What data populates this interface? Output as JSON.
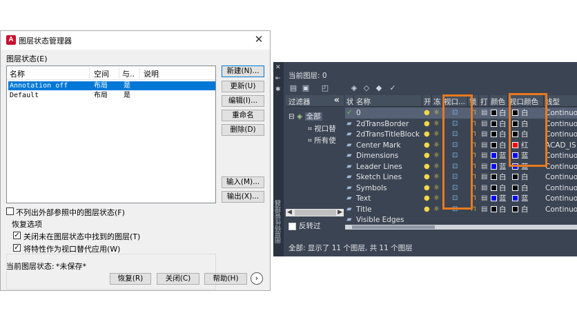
{
  "dialog": {
    "title": "图层状态管理器",
    "close_glyph": "✕",
    "section_label": "图层状态(E)",
    "columns": [
      "名称",
      "空间",
      "与..",
      "说明"
    ],
    "rows": [
      {
        "name": "Annotation off",
        "space": "布局",
        "match": "是",
        "desc": "",
        "selected": true
      },
      {
        "name": "Default",
        "space": "布局",
        "match": "是",
        "desc": "",
        "selected": false
      }
    ],
    "buttons": {
      "new": "新建(N)...",
      "update": "更新(U)",
      "edit": "编辑(I)...",
      "rename": "重命名",
      "delete": "删除(D)",
      "import": "输入(M)...",
      "export": "输出(X)..."
    },
    "exclude_xref_label": "不列出外部参照中的图层状态(F)",
    "restore_group_label": "恢复选项",
    "restore_opt1": "关闭未在图层状态中找到的图层(T)",
    "restore_opt2": "将特性作为视口替代应用(W)",
    "current_state_label": "当前图层状态:",
    "current_state_value": "*未保存*",
    "footer": {
      "restore": "恢复(R)",
      "close": "关闭(C)",
      "help": "帮助(H)",
      "more_glyph": "›"
    }
  },
  "palette": {
    "current_layer": "当前图层: 0",
    "vertical_title": "图层特性管理器",
    "filter_header": "过滤器",
    "collapse_glyph": "«",
    "tree_all": "全部",
    "tree_item1": "视口替",
    "tree_item2": "所有使",
    "invert_label": "反转过",
    "columns": {
      "status": "状",
      "name": "名称",
      "on": "开",
      "freeze": "冻",
      "vp_freeze": "视口...",
      "lock": "锁",
      "plot": "打",
      "color": "颜色",
      "vp_color": "视口颜色",
      "linetype": "线型"
    },
    "layers": [
      {
        "name": "0",
        "color": "白",
        "swatch": "#000000",
        "vp_color": "白",
        "vp_swatch": "#000000",
        "linetype": "Continuo",
        "current": true
      },
      {
        "name": "2dTransBorder",
        "color": "白",
        "swatch": "#000000",
        "vp_color": "白",
        "vp_swatch": "#000000",
        "linetype": "Continuo",
        "current": false
      },
      {
        "name": "2dTransTitleBlock",
        "color": "白",
        "swatch": "#000000",
        "vp_color": "白",
        "vp_swatch": "#000000",
        "linetype": "Continuo",
        "current": false
      },
      {
        "name": "Center Mark",
        "color": "白",
        "swatch": "#000000",
        "vp_color": "红",
        "vp_swatch": "#ff0000",
        "linetype": "ACAD_IS",
        "current": false
      },
      {
        "name": "Dimensions",
        "color": "蓝",
        "swatch": "#0000ff",
        "vp_color": "蓝",
        "vp_swatch": "#0000ff",
        "linetype": "Continuo",
        "current": false
      },
      {
        "name": "Leader Lines",
        "color": "蓝",
        "swatch": "#0000ff",
        "vp_color": "蓝",
        "vp_swatch": "#0000ff",
        "linetype": "Continuo",
        "current": false
      },
      {
        "name": "Sketch Lines",
        "color": "白",
        "swatch": "#000000",
        "vp_color": "白",
        "vp_swatch": "#000000",
        "linetype": "Continuo",
        "current": false
      },
      {
        "name": "Symbols",
        "color": "白",
        "swatch": "#000000",
        "vp_color": "白",
        "vp_swatch": "#000000",
        "linetype": "Continuo",
        "current": false
      },
      {
        "name": "Text",
        "color": "蓝",
        "swatch": "#0000ff",
        "vp_color": "蓝",
        "vp_swatch": "#0000ff",
        "linetype": "Continuo",
        "current": false
      },
      {
        "name": "Title",
        "color": "白",
        "swatch": "#000000",
        "vp_color": "白",
        "vp_swatch": "#000000",
        "linetype": "Continuo",
        "current": false
      },
      {
        "name": "Visible Edges",
        "color": "",
        "swatch": "",
        "vp_color": "",
        "vp_swatch": "",
        "linetype": "",
        "current": false
      }
    ],
    "status_text": "全部: 显示了 11 个图层, 共 11 个图层",
    "highlight_color": "#ea7a1c"
  }
}
